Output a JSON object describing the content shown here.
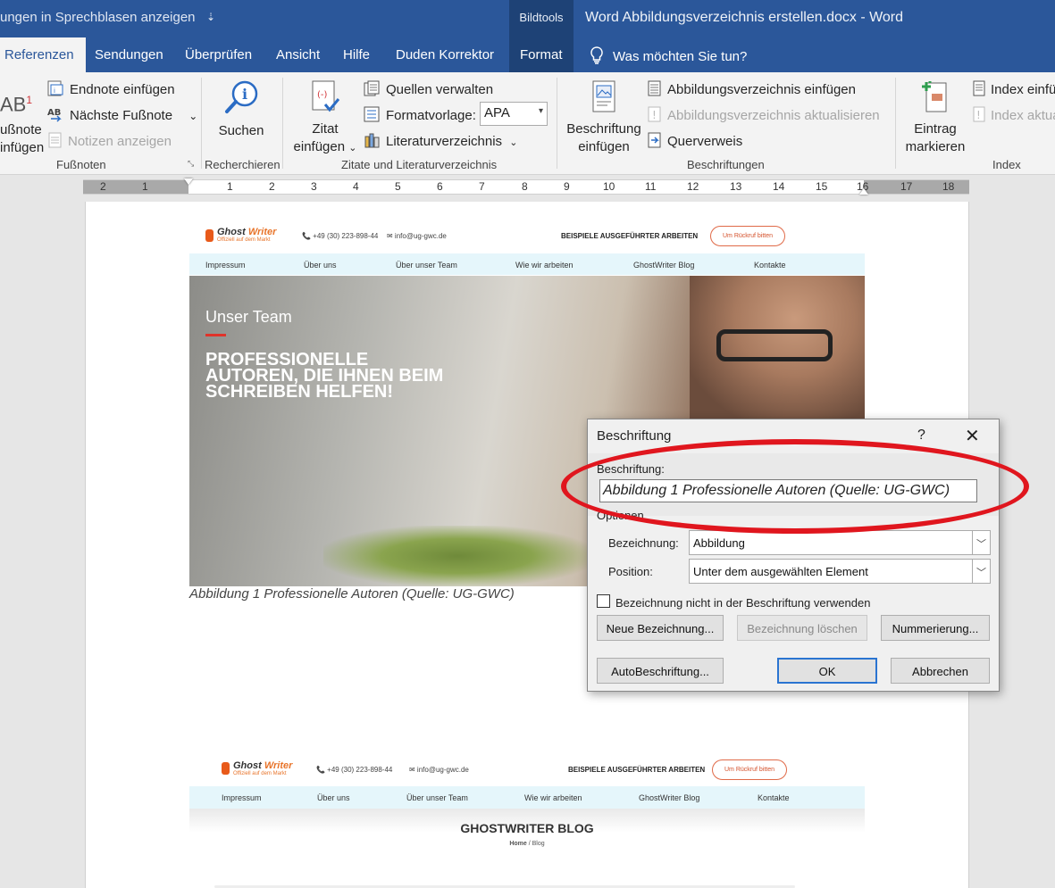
{
  "titlebar": {
    "qat_text": "ungen in Sprechblasen anzeigen",
    "qat_arrow": "⇣",
    "context_tools": "Bildtools",
    "doc_title": "Word Abbildungsverzeichnis erstellen.docx  -  Word"
  },
  "tabs": {
    "referenzen": "Referenzen",
    "sendungen": "Sendungen",
    "ueberpruefen": "Überprüfen",
    "ansicht": "Ansicht",
    "hilfe": "Hilfe",
    "duden": "Duden Korrektor",
    "format": "Format",
    "tellme": "Was möchten Sie tun?"
  },
  "ribbon": {
    "fussnoten": {
      "ab_glyph": "AB",
      "ab_sup": "1",
      "fussnote_line1": "ußnote",
      "fussnote_line2": "infügen",
      "endnote": "Endnote einfügen",
      "naechste": "Nächste Fußnote",
      "naechste_arrow": "⌄",
      "notizen": "Notizen anzeigen",
      "label": "Fußnoten"
    },
    "recherchieren": {
      "suchen": "Suchen",
      "label": "Recherchieren"
    },
    "zitate": {
      "zitat_line1": "Zitat",
      "zitat_line2": "einfügen",
      "zitat_arrow": "⌄",
      "quellen": "Quellen verwalten",
      "formatvorlage": "Formatvorlage:",
      "apa": "APA",
      "literatur": "Literaturverzeichnis",
      "literatur_arrow": "⌄",
      "label": "Zitate und Literaturverzeichnis"
    },
    "beschriftungen": {
      "beschriftung_line1": "Beschriftung",
      "beschriftung_line2": "einfügen",
      "abb_einfuegen": "Abbildungsverzeichnis einfügen",
      "abb_aktualisieren": "Abbildungsverzeichnis aktualisieren",
      "querverweis": "Querverweis",
      "label": "Beschriftungen"
    },
    "index": {
      "eintrag_line1": "Eintrag",
      "eintrag_line2": "markieren",
      "index_einf": "Index einfü",
      "index_akt": "Index aktua",
      "label": "Index"
    }
  },
  "ruler": {
    "numbers": [
      "2",
      "1",
      "1",
      "2",
      "3",
      "4",
      "5",
      "6",
      "7",
      "8",
      "9",
      "10",
      "11",
      "12",
      "13",
      "14",
      "15",
      "16",
      "17",
      "18"
    ]
  },
  "site1": {
    "logo_a": "Ghost ",
    "logo_b": "Writer",
    "logo_sub": "Offiziell auf dem Markt",
    "phone": "📞 +49 (30) 223-898-44",
    "mail": "✉ info@ug-gwc.de",
    "beispiele": "BEISPIELE AUSGEFÜHRTER ARBEITEN",
    "rueckruf": "Um Rückruf bitten",
    "nav": [
      "Impressum",
      "Über uns",
      "Über unser Team",
      "Wie wir arbeiten",
      "GhostWriter Blog",
      "Kontakte"
    ],
    "hero_small": "Unser Team",
    "hero_big_1": "PROFESSIONELLE",
    "hero_big_2": "AUTOREN, DIE IHNEN BEIM",
    "hero_big_3": "SCHREIBEN HELFEN!"
  },
  "image_caption": "Abbildung 1 Professionelle  Autoren (Quelle: UG-GWC)",
  "site2": {
    "logo_a": "Ghost ",
    "logo_b": "Writer",
    "logo_sub": "Offiziell auf dem Markt",
    "phone": "📞 +49 (30) 223-898-44",
    "mail": "✉ info@ug-gwc.de",
    "beispiele": "BEISPIELE AUSGEFÜHRTER ARBEITEN",
    "rueckruf": "Um Rückruf bitten",
    "nav": [
      "Impressum",
      "Über uns",
      "Über unser Team",
      "Wie wir arbeiten",
      "GhostWriter Blog",
      "Kontakte"
    ],
    "blog_title": "GHOSTWRITER BLOG",
    "breadcrumb_home": "Home",
    "breadcrumb_sep": " / ",
    "breadcrumb_blog": "Blog"
  },
  "dialog": {
    "title": "Beschriftung",
    "help": "?",
    "close": "✕",
    "beschriftung_label": "Beschriftung:",
    "caption_value": "Abbildung 1 Professionelle  Autoren (Quelle: UG-GWC)",
    "optionen_label": "Optionen",
    "bezeichnung_label": "Bezeichnung:",
    "bezeichnung_value": "Abbildung",
    "position_label": "Position:",
    "position_value": "Unter dem ausgewählten Element",
    "checkbox_label": "Bezeichnung nicht in der Beschriftung verwenden",
    "neue_bezeichnung": "Neue Bezeichnung...",
    "bezeichnung_loeschen": "Bezeichnung löschen",
    "nummerierung": "Nummerierung...",
    "autobeschriftung": "AutoBeschriftung...",
    "ok": "OK",
    "abbrechen": "Abbrechen"
  },
  "colors": {
    "word_blue": "#2b579a",
    "highlight_red": "#e0161e",
    "brand_orange": "#e8742a"
  }
}
